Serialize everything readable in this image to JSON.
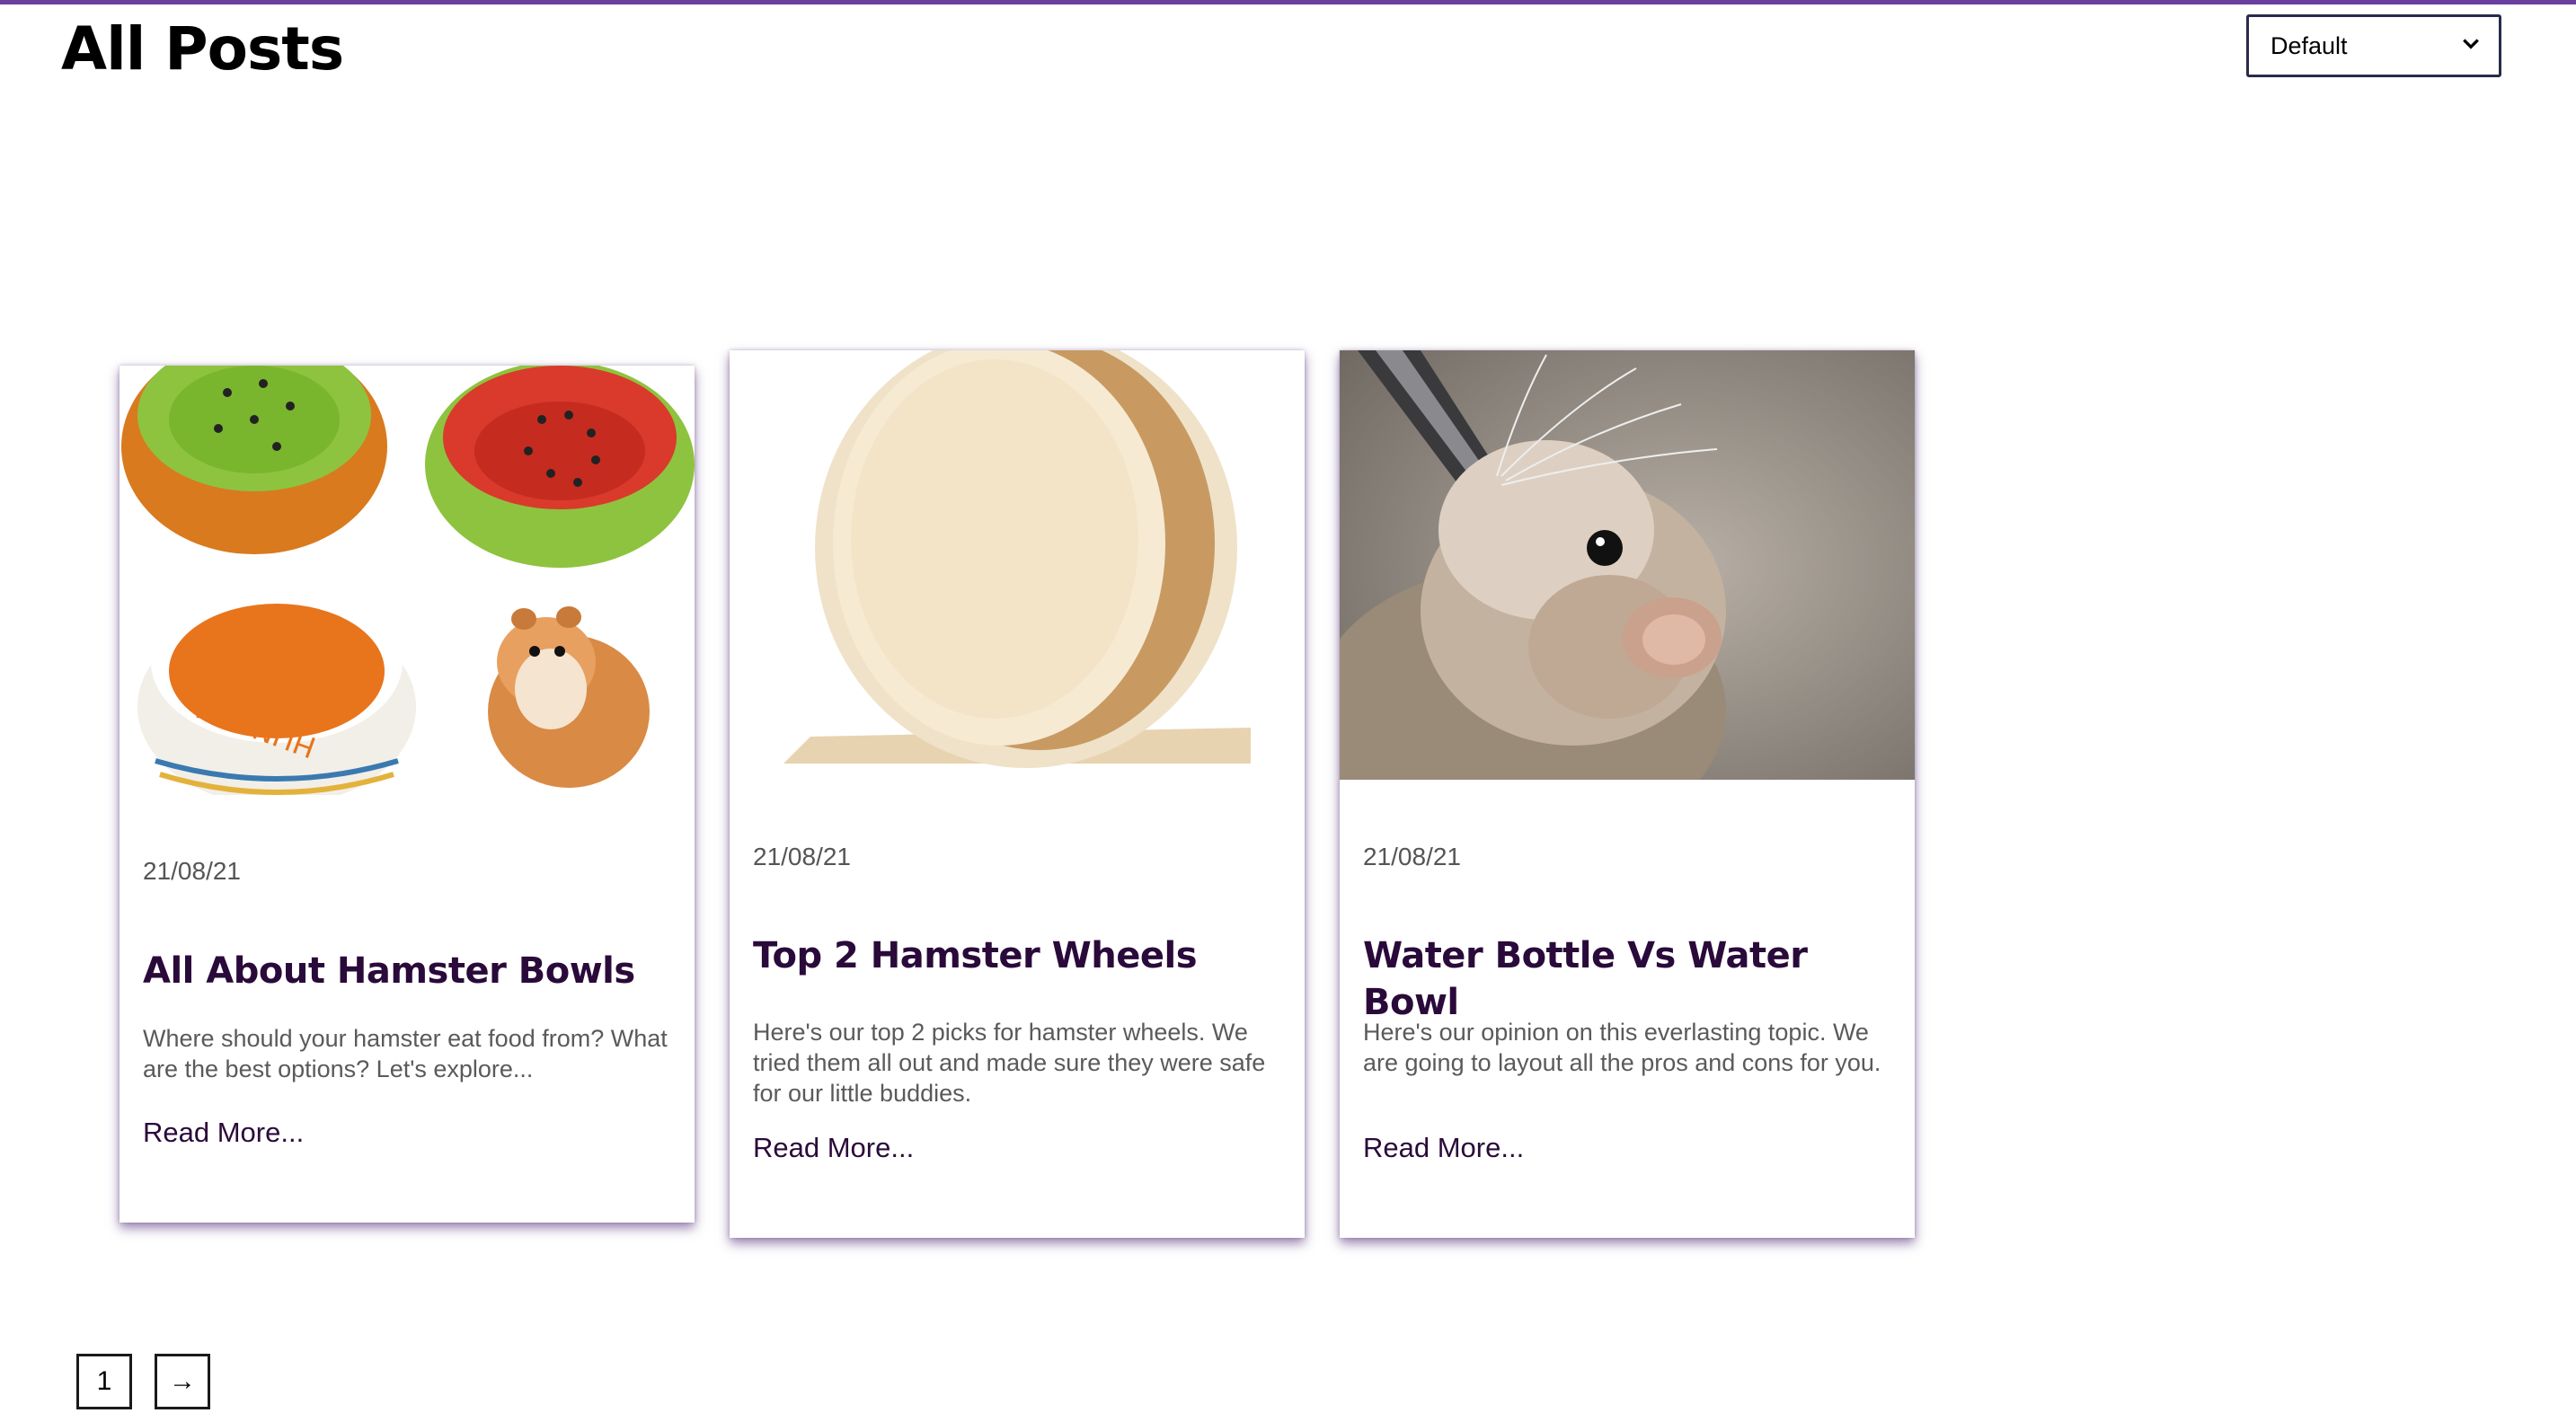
{
  "header": {
    "title": "All Posts",
    "sort": {
      "selected": "Default",
      "options": [
        "Default"
      ]
    }
  },
  "posts": [
    {
      "date": "21/08/21",
      "title": "All About Hamster Bowls",
      "excerpt": "Where should your hamster eat food from? What are the best options? Let's explore...",
      "read_more": "Read More...",
      "image_alt": "hamster-bowls-image"
    },
    {
      "date": "21/08/21",
      "title": "Top 2 Hamster Wheels",
      "excerpt": "Here's our top 2 picks for hamster wheels. We tried them all out and made sure they were safe for our little buddies.",
      "read_more": "Read More...",
      "image_alt": "hamster-wheel-image"
    },
    {
      "date": "21/08/21",
      "title": "Water Bottle Vs Water Bowl",
      "excerpt": "Here's our opinion on this everlasting topic. We are going to layout all the pros and cons for you.",
      "read_more": "Read More...",
      "image_alt": "hamster-drinking-image"
    }
  ],
  "pagination": {
    "current": "1",
    "next_symbol": "→"
  },
  "colors": {
    "accent": "#6b3fa0",
    "title_text": "#2a0a3a"
  }
}
